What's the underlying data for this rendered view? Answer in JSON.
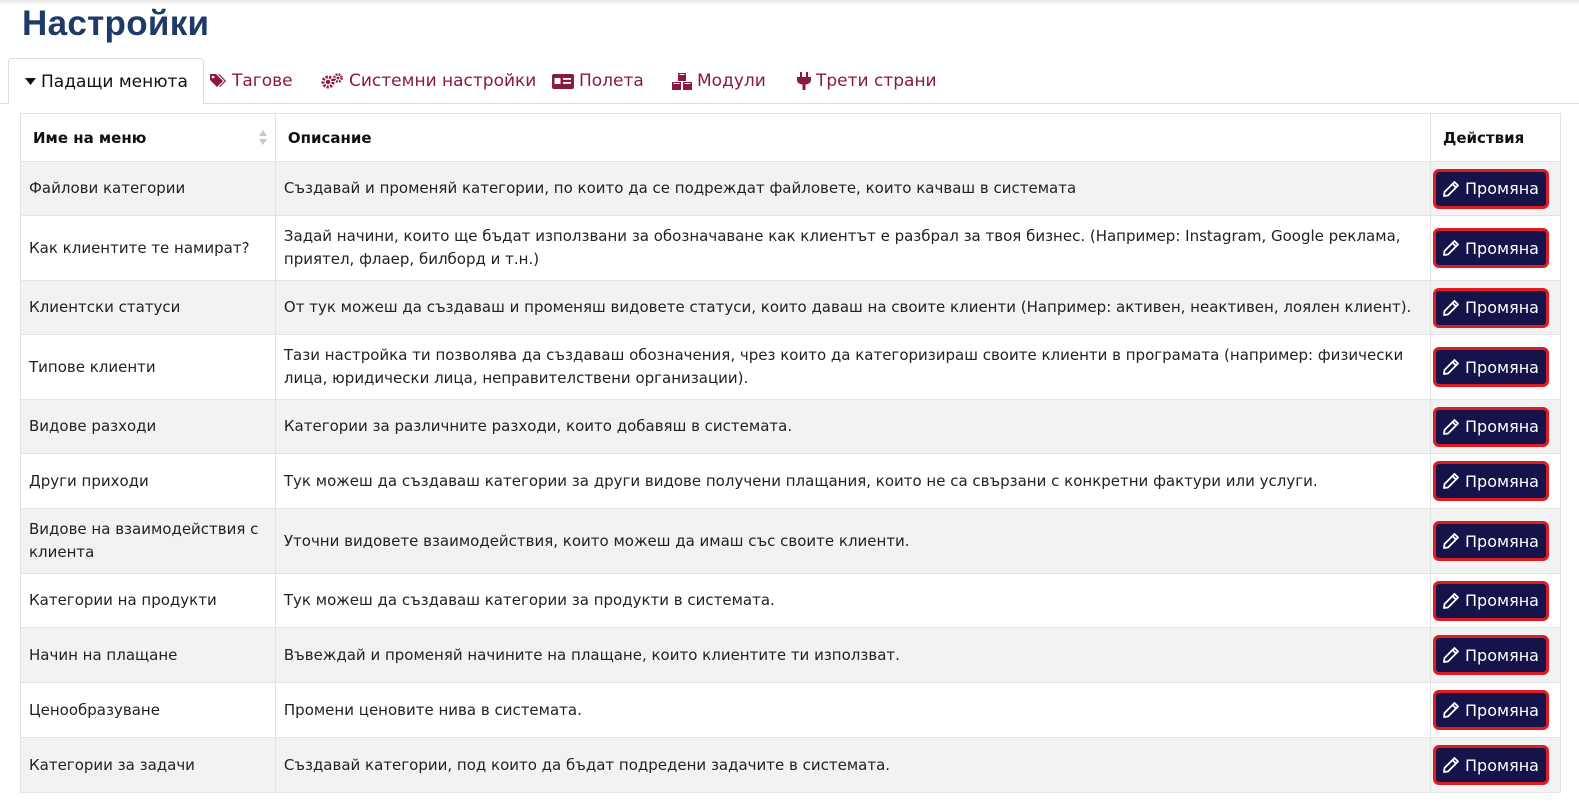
{
  "page": {
    "title": "Настройки"
  },
  "tabs": [
    {
      "label": "Падащи менюта",
      "icon": "caret-down-icon",
      "active": true
    },
    {
      "label": "Тагове",
      "icon": "tags-icon"
    },
    {
      "label": "Системни настройки",
      "icon": "cogs-icon"
    },
    {
      "label": "Полета",
      "icon": "id-card-icon"
    },
    {
      "label": "Модули",
      "icon": "cubes-icon"
    },
    {
      "label": "Трети страни",
      "icon": "plug-icon"
    }
  ],
  "table": {
    "headers": {
      "name": "Име на меню",
      "description": "Описание",
      "actions": "Действия"
    },
    "edit_label": "Промяна",
    "rows": [
      {
        "name": "Файлови категории",
        "description": "Създавай и променяй категории, по които да се подреждат файловете, които качваш в системата"
      },
      {
        "name": "Как клиентите те намират?",
        "description": "Задай начини, които ще бъдат използвани за обозначаване как клиентът е разбрал за твоя бизнес. (Например: Instagram, Google реклама, приятел, флаер, билборд и т.н.)"
      },
      {
        "name": "Клиентски статуси",
        "description": "От тук можеш да създаваш и променяш видовете статуси, които даваш на своите клиенти (Например: активен, неактивен, лоялен клиент)."
      },
      {
        "name": "Типове клиенти",
        "description": "Тази настройка ти позволява да създаваш обозначения, чрез които да категоризираш своите клиенти в програмата (например: физически лица, юридически лица, неправителствени организации)."
      },
      {
        "name": "Видове разходи",
        "description": "Категории за различните разходи, които добавяш в системата."
      },
      {
        "name": "Други приходи",
        "description": "Тук можеш да създаваш категории за други видове получени плащания, които не са свързани с конкретни фактури или услуги."
      },
      {
        "name": "Видове на взаимодействия с клиента",
        "description": "Уточни видовете взаимодействия, които можеш да имаш със своите клиенти."
      },
      {
        "name": "Категории на продукти",
        "description": "Тук можеш да създаваш категории за продукти в системата."
      },
      {
        "name": "Начин на плащане",
        "description": "Въвеждай и променяй начините на плащане, които клиентите ти използват."
      },
      {
        "name": "Ценообразуване",
        "description": "Промени ценовите нива в системата."
      },
      {
        "name": "Категории за задачи",
        "description": "Създавай категории, под които да бъдат подредени задачите в системата."
      }
    ]
  },
  "colors": {
    "title": "#1f3a68",
    "tab_link": "#8c1a3c",
    "button_bg": "#15144a",
    "button_border": "#e01b24"
  }
}
